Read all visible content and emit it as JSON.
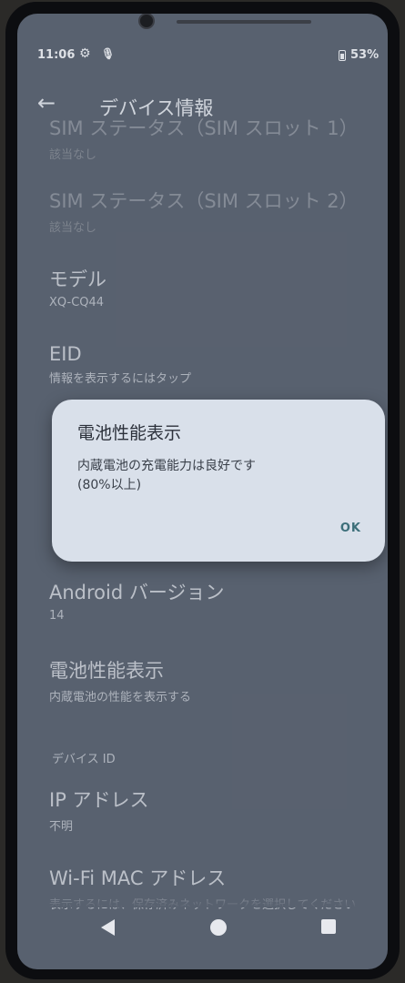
{
  "status_bar": {
    "time": "11:06",
    "battery": "53%"
  },
  "app_bar": {
    "back_icon": "←",
    "title": "デバイス情報"
  },
  "list": [
    {
      "title": "SIM ステータス（SIM スロット 1）",
      "subtitle": "該当なし",
      "dim": true
    },
    {
      "title": "SIM ステータス（SIM スロット 2）",
      "subtitle": "該当なし",
      "dim": true
    },
    {
      "title": "モデル",
      "subtitle": "XQ-CQ44"
    },
    {
      "title": "EID",
      "subtitle": "情報を表示するにはタップ"
    },
    {
      "title": "Android バージョン",
      "subtitle": "14"
    },
    {
      "title": "電池性能表示",
      "subtitle": "内蔵電池の性能を表示する"
    },
    {
      "title": "IP アドレス",
      "subtitle": "不明"
    },
    {
      "title": "Wi-Fi MAC アドレス",
      "subtitle": "表示するには、保存済みネットワークを選択してください"
    }
  ],
  "section_header": "デバイス ID",
  "dialog": {
    "title": "電池性能表示",
    "message": "内蔵電池の充電能力は良好です\n(80%以上)",
    "ok_label": "OK"
  },
  "icons": {
    "settings": "gear-icon",
    "mic": "mic-icon",
    "battery": "battery-icon",
    "nav_back": "nav-back-icon",
    "nav_home": "nav-home-icon",
    "nav_recents": "nav-recents-icon"
  },
  "colors": {
    "screen_bg": "#5d6573",
    "dialog_bg": "#d9e0ea",
    "accent": "#3d6f7a"
  }
}
